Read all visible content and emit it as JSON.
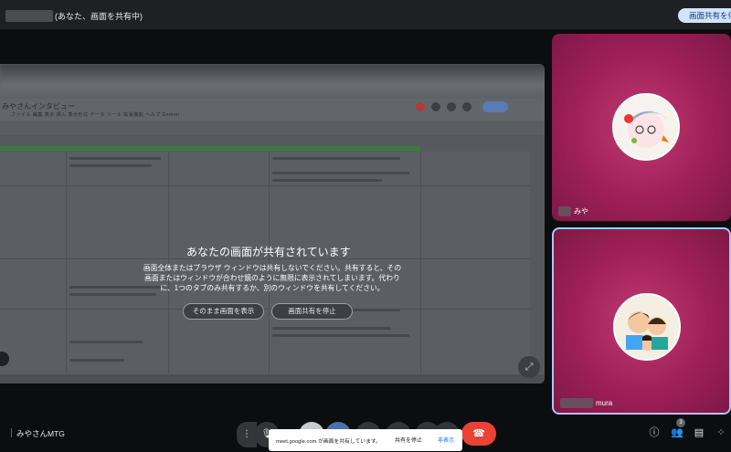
{
  "topbar": {
    "tab_status": "(あなた、画面を共有中)",
    "stop_sharing_label": "画面共有を停止"
  },
  "shared_screen": {
    "document_title": "みやさんインタビュー",
    "document_menu": "ファイル 編集 表示 挿入 表示形式 データ ツール 拡張機能 ヘルプ Gemini",
    "overlay": {
      "title": "あなたの画面が共有されています",
      "description": "画面全体またはブラウザ ウィンドウは共有しないでください。共有すると、その画面またはウィンドウが合わせ鏡のように無限に表示されてしまいます。代わりに、1つのタブのみ共有するか、別のウィンドウを共有してください。",
      "show_anyway_label": "そのまま画面を表示",
      "stop_sharing_label": "画面共有を停止"
    }
  },
  "participants": [
    {
      "name": "みや"
    },
    {
      "name": "mura"
    }
  ],
  "bottom_bar": {
    "meeting_name": "みやさんMTG",
    "notice_message": "meet.google.com が画面を共有しています。",
    "notice_stop_label": "共有を停止",
    "notice_hide_label": "非表示",
    "people_count": "3"
  },
  "colors": {
    "tile_background": "#9e2057",
    "end_call": "#ea4335",
    "active_speaker_border": "#a8c7fa",
    "stop_sharing_pill": "#d2e3fc"
  },
  "icons": [
    "mic-icon",
    "camera-icon",
    "captions-icon",
    "emoji-icon",
    "present-icon",
    "raise-hand-icon",
    "more-icon",
    "end-call-icon",
    "info-icon",
    "people-icon",
    "chat-icon",
    "activities-icon",
    "fullscreen-icon"
  ]
}
